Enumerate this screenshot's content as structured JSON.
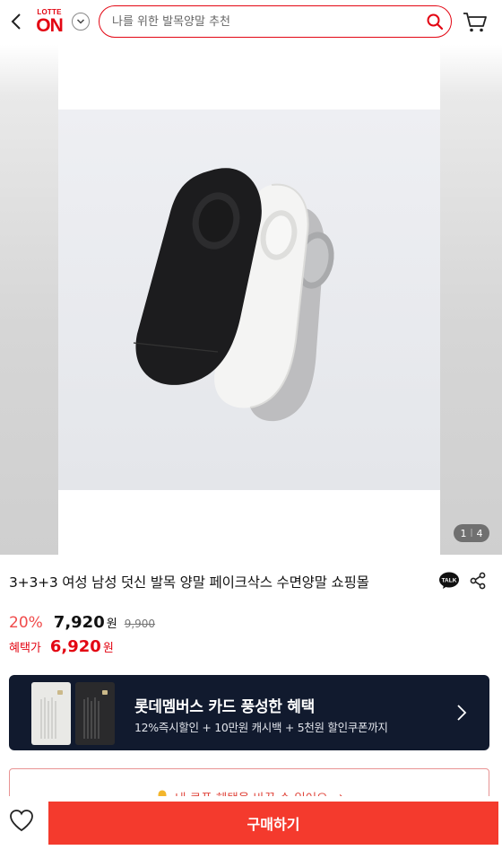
{
  "header": {
    "logo_top": "LOTTE",
    "logo_main": "ON",
    "search_placeholder": "나를 위한 발목양말 추천",
    "icons": [
      "back-arrow-icon",
      "chevron-down-icon",
      "search-icon",
      "cart-icon"
    ]
  },
  "gallery": {
    "current": "1",
    "separator": "|",
    "total": "4"
  },
  "product": {
    "title": "3+3+3 여성 남성 덧신 발목 양말 페이크삭스 수면양말 쇼핑몰",
    "discount": "20%",
    "price": "7,920",
    "won": "원",
    "original_price": "9,900",
    "benefit_label": "혜택가",
    "benefit_price": "6,920",
    "benefit_won": "원"
  },
  "card_banner": {
    "title": "롯데멤버스 카드 풍성한 혜택",
    "subtitle": "12%즉시할인 + 10만원 캐시백 + 5천원 할인쿠폰까지",
    "colors": {
      "background": "#111a2e"
    }
  },
  "coupon": {
    "text": "내 쿠폰 혜택을 바꿀 수 있어요",
    "arrow": "→"
  },
  "bottom_bar": {
    "buy_label": "구매하기",
    "colors": {
      "buy": "#f43a2d"
    }
  },
  "colors": {
    "brand": "#e30613",
    "discount": "#f04b4b"
  }
}
